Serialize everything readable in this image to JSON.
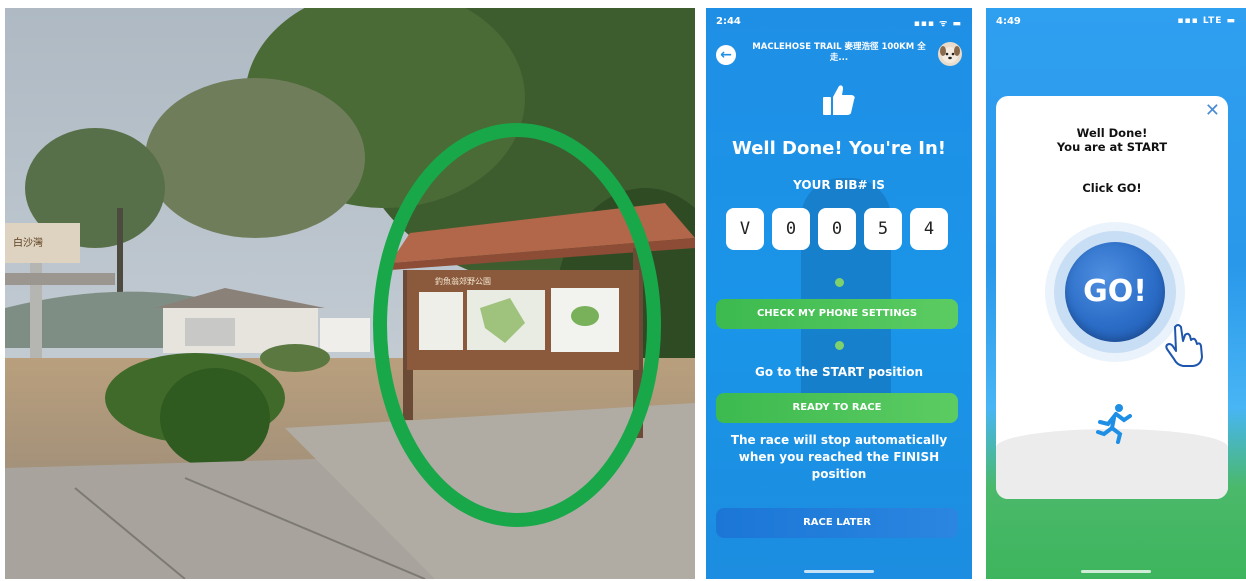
{
  "photo": {
    "sign_text": "釣魚翁郊野公園",
    "left_sign_text": "白沙灣"
  },
  "phone2": {
    "status_time": "2:44",
    "status_icons": "▪▪▪ ᯤ ▬",
    "header_title": "MACLEHOSE TRAIL 麥理浩徑 100KM 全走...",
    "headline": "Well Done! You're In!",
    "bib_label": "YOUR BIB# IS",
    "bib_digits": [
      "V",
      "0",
      "0",
      "5",
      "4"
    ],
    "check_settings_label": "CHECK MY PHONE SETTINGS",
    "start_position_text": "Go to the START position",
    "ready_label": "READY TO RACE",
    "race_stop_text": "The race will stop automatically when you reached the FINISH position",
    "race_later_label": "RACE LATER"
  },
  "phone3": {
    "status_time": "4:49",
    "status_icons": "▪▪▪ LTE ▬",
    "modal_title": "Well Done!\nYou are at START",
    "modal_subtitle": "Click GO!",
    "go_label": "GO!",
    "close_glyph": "✕"
  },
  "colors": {
    "accent_blue": "#1f8fe6",
    "button_green": "#3cba4f",
    "button_blue": "#1b76d6",
    "highlight_green": "#18a84a"
  }
}
